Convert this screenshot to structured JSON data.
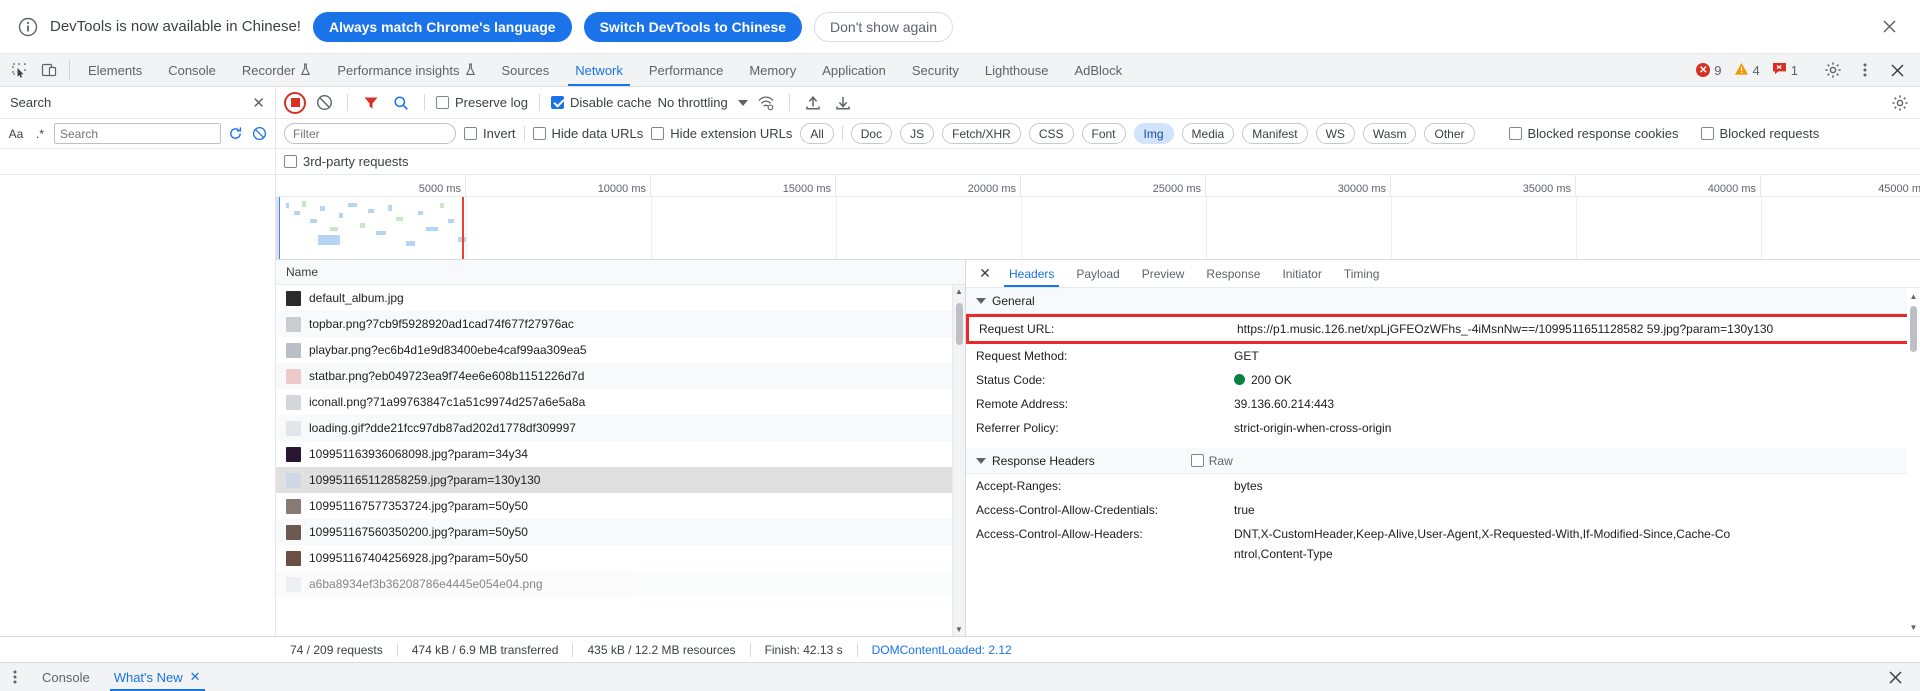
{
  "infobar": {
    "icon": "info-icon",
    "message": "DevTools is now available in Chinese!",
    "buttons": [
      {
        "label": "Always match Chrome's language",
        "style": "primary"
      },
      {
        "label": "Switch DevTools to Chinese",
        "style": "primary"
      },
      {
        "label": "Don't show again",
        "style": "ghost"
      }
    ],
    "close": "✕"
  },
  "tabbar": {
    "inspect_icon": "inspect-element-icon",
    "device_icon": "device-toolbar-icon",
    "tabs": [
      {
        "label": "Elements",
        "active": false,
        "flask": false
      },
      {
        "label": "Console",
        "active": false,
        "flask": false
      },
      {
        "label": "Recorder",
        "active": false,
        "flask": true
      },
      {
        "label": "Performance insights",
        "active": false,
        "flask": true
      },
      {
        "label": "Sources",
        "active": false,
        "flask": false
      },
      {
        "label": "Network",
        "active": true,
        "flask": false
      },
      {
        "label": "Performance",
        "active": false,
        "flask": false
      },
      {
        "label": "Memory",
        "active": false,
        "flask": false
      },
      {
        "label": "Application",
        "active": false,
        "flask": false
      },
      {
        "label": "Security",
        "active": false,
        "flask": false
      },
      {
        "label": "Lighthouse",
        "active": false,
        "flask": false
      },
      {
        "label": "AdBlock",
        "active": false,
        "flask": false
      }
    ],
    "flask_glyph": "⚗",
    "errors": "9",
    "warnings": "4",
    "issues": "1",
    "settings_icon": "gear-icon",
    "more_icon": "more-vertical-icon",
    "close_icon": "close-icon"
  },
  "search_panel": {
    "title": "Search",
    "close": "✕",
    "match_case_label": "Aa",
    "regex_label": ".*",
    "input_placeholder": "Search",
    "input_value": "",
    "refresh_icon": "refresh-icon",
    "clear_icon": "clear-icon"
  },
  "network_toolbar": {
    "record_icon": "record-stop-icon",
    "clear_icon": "clear-network-log-icon",
    "filter_icon": "filter-icon",
    "search_icon": "search-icon",
    "preserve_log": {
      "label": "Preserve log",
      "checked": false
    },
    "disable_cache": {
      "label": "Disable cache",
      "checked": true
    },
    "throttle_value": "No throttling",
    "network_conditions_icon": "network-conditions-icon",
    "import_icon": "import-har-icon",
    "export_icon": "export-har-icon",
    "settings_icon": "network-settings-gear-icon"
  },
  "filterbar": {
    "filter_placeholder": "Filter",
    "filter_value": "",
    "invert": {
      "label": "Invert",
      "checked": false
    },
    "hide_data_urls": {
      "label": "Hide data URLs",
      "checked": false
    },
    "hide_extension_urls": {
      "label": "Hide extension URLs",
      "checked": false
    },
    "types": [
      {
        "label": "All",
        "active": false
      },
      {
        "label": "Doc",
        "active": false
      },
      {
        "label": "JS",
        "active": false
      },
      {
        "label": "Fetch/XHR",
        "active": false
      },
      {
        "label": "CSS",
        "active": false
      },
      {
        "label": "Font",
        "active": false
      },
      {
        "label": "Img",
        "active": true
      },
      {
        "label": "Media",
        "active": false
      },
      {
        "label": "Manifest",
        "active": false
      },
      {
        "label": "WS",
        "active": false
      },
      {
        "label": "Wasm",
        "active": false
      },
      {
        "label": "Other",
        "active": false
      }
    ],
    "blocked_response_cookies": {
      "label": "Blocked response cookies",
      "checked": false
    },
    "blocked_requests": {
      "label": "Blocked requests",
      "checked": false
    },
    "third_party": {
      "label": "3rd-party requests",
      "checked": false
    }
  },
  "overview": {
    "ticks": [
      "5000 ms",
      "10000 ms",
      "15000 ms",
      "20000 ms",
      "25000 ms",
      "30000 ms",
      "35000 ms",
      "40000 ms",
      "45000 m"
    ]
  },
  "request_list": {
    "column_header": "Name",
    "rows": [
      {
        "name": "default_album.jpg",
        "icon_color": "#2b2b2b",
        "selected": false
      },
      {
        "name": "topbar.png?7cb9f5928920ad1cad74f677f27976ac",
        "icon_color": "#c8cdd2",
        "selected": false
      },
      {
        "name": "playbar.png?ec6b4d1e9d83400ebe4caf99aa309ea5",
        "icon_color": "#b9bfc5",
        "selected": false
      },
      {
        "name": "statbar.png?eb049723ea9f74ee6e608b1151226d7d",
        "icon_color": "#efc9c9",
        "selected": false
      },
      {
        "name": "iconall.png?71a99763847c1a51c9974d257a6e5a8a",
        "icon_color": "#d4d8dc",
        "selected": false
      },
      {
        "name": "loading.gif?dde21fcc97db87ad202d1778df309997",
        "icon_color": "#e3e6e9",
        "selected": false
      },
      {
        "name": "109951163936068098.jpg?param=34y34",
        "icon_color": "#2a1533",
        "selected": false
      },
      {
        "name": "109951165112858259.jpg?param=130y130",
        "icon_color": "#cfd9e6",
        "selected": true
      },
      {
        "name": "109951167577353724.jpg?param=50y50",
        "icon_color": "#8a7a74",
        "selected": false
      },
      {
        "name": "109951167560350200.jpg?param=50y50",
        "icon_color": "#6d5a4e",
        "selected": false
      },
      {
        "name": "109951167404256928.jpg?param=50y50",
        "icon_color": "#6b4f45",
        "selected": false
      },
      {
        "name": "a6ba8934ef3b36208786e4445e054e04.png",
        "icon_color": "#dfe3e6",
        "selected": false
      }
    ]
  },
  "details": {
    "close": "✕",
    "tabs": [
      {
        "label": "Headers",
        "active": true
      },
      {
        "label": "Payload",
        "active": false
      },
      {
        "label": "Preview",
        "active": false
      },
      {
        "label": "Response",
        "active": false
      },
      {
        "label": "Initiator",
        "active": false
      },
      {
        "label": "Timing",
        "active": false
      }
    ],
    "general": {
      "section_title": "General",
      "rows": [
        {
          "key": "Request URL:",
          "value": "https://p1.music.126.net/xpLjGFEOzWFhs_-4iMsnNw==/1099511651128582 59.jpg?param=130y130",
          "highlighted": true
        },
        {
          "key": "Request Method:",
          "value": "GET",
          "highlighted": false
        },
        {
          "key": "Status Code:",
          "value": "200 OK",
          "highlighted": false,
          "status_dot": "#0b8043"
        },
        {
          "key": "Remote Address:",
          "value": "39.136.60.214:443",
          "highlighted": false
        },
        {
          "key": "Referrer Policy:",
          "value": "strict-origin-when-cross-origin",
          "highlighted": false
        }
      ]
    },
    "response_headers": {
      "section_title": "Response Headers",
      "raw_label": "Raw",
      "raw_checked": false,
      "rows": [
        {
          "key": "Accept-Ranges:",
          "value": "bytes"
        },
        {
          "key": "Access-Control-Allow-Credentials:",
          "value": "true"
        },
        {
          "key": "Access-Control-Allow-Headers:",
          "value": "DNT,X-CustomHeader,Keep-Alive,User-Agent,X-Requested-With,If-Modified-Since,Cache-Control,Content-Type"
        }
      ]
    }
  },
  "statusbar": {
    "requests": "74 / 209 requests",
    "transferred": "474 kB / 6.9 MB transferred",
    "resources": "435 kB / 12.2 MB resources",
    "finish": "Finish: 42.13 s",
    "domcontentloaded": "DOMContentLoaded: 2.12"
  },
  "drawer": {
    "more_icon": "more-vertical-icon",
    "tabs": [
      {
        "label": "Console",
        "active": false,
        "closable": false
      },
      {
        "label": "What's New",
        "active": true,
        "closable": true
      }
    ],
    "tab_close": "✕",
    "close_icon": "close-icon",
    "close": "✕"
  }
}
